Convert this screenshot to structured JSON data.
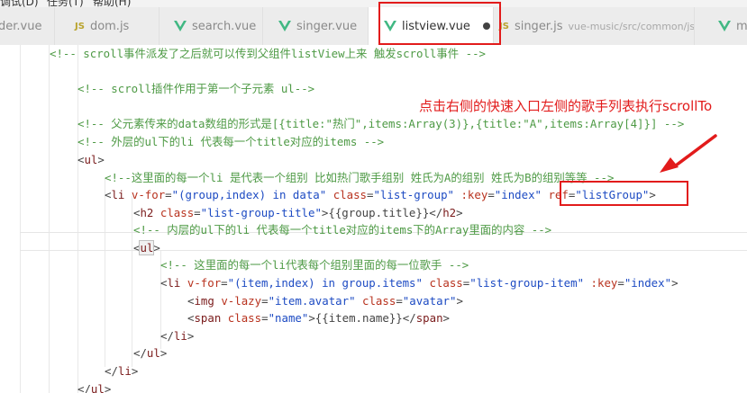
{
  "menu": [
    {
      "label": "调试(D)"
    },
    {
      "label": "任务(T)"
    },
    {
      "label": "帮助(H)"
    }
  ],
  "tabs": [
    {
      "name": "der.vue",
      "icon": "none"
    },
    {
      "name": "dom.js",
      "icon": "js"
    },
    {
      "name": "search.vue",
      "icon": "vue"
    },
    {
      "name": "singer.vue",
      "icon": "vue"
    },
    {
      "name": "listview.vue",
      "icon": "vue",
      "active": true,
      "modified": true
    },
    {
      "name": "singer.js",
      "icon": "js",
      "path": "vue-music/src/common/js"
    },
    {
      "name": "m",
      "icon": "vue"
    }
  ],
  "icons": {
    "js": "JS",
    "vue": "vue-logo-icon",
    "modified": "unsaved-dot-icon"
  },
  "colors": {
    "annotation": "#e21b1b",
    "comment": "#4e9a45",
    "tag": "#7a1b1b",
    "attr": "#b8321e",
    "string": "#1d4bc3"
  },
  "annotation": "点击右侧的快速入口左侧的歌手列表执行scrollTo",
  "code": [
    [
      {
        "k": "c",
        "t": "<!-- scroll事件派发了之后就可以传到父组件listView上来 触发scroll事件 -->"
      }
    ],
    [],
    [
      {
        "k": "c",
        "t": "<!-- scroll插件作用于第一个子元素 ul-->"
      }
    ],
    [],
    [
      {
        "k": "c",
        "t": "<!-- 父元素传来的data数组的形式是[{title:\"热门\",items:Array(3)},{title:\"A\",items:Array[4]}] -->"
      }
    ],
    [
      {
        "k": "c",
        "t": "<!-- 外层的ul下的li 代表每一个title对应的items -->"
      }
    ],
    [
      {
        "k": "p",
        "t": "<"
      },
      {
        "k": "t",
        "t": "ul"
      },
      {
        "k": "p",
        "t": ">"
      }
    ],
    [
      {
        "k": "c",
        "t": "<!--这里面的每一个li 是代表一个组别 比如热门歌手组别 姓氏为A的组别 姓氏为B的组别等等 -->"
      }
    ],
    [
      {
        "k": "p",
        "t": "<"
      },
      {
        "k": "t",
        "t": "li"
      },
      {
        "k": "p",
        "t": " "
      },
      {
        "k": "a",
        "t": "v-for"
      },
      {
        "k": "p",
        "t": "="
      },
      {
        "k": "s",
        "t": "\"(group,index) in data\""
      },
      {
        "k": "p",
        "t": " "
      },
      {
        "k": "a",
        "t": "class"
      },
      {
        "k": "p",
        "t": "="
      },
      {
        "k": "s",
        "t": "\"list-group\""
      },
      {
        "k": "p",
        "t": " "
      },
      {
        "k": "a",
        "t": ":key"
      },
      {
        "k": "p",
        "t": "="
      },
      {
        "k": "s",
        "t": "\"index\""
      },
      {
        "k": "p",
        "t": " "
      },
      {
        "k": "a",
        "t": "ref"
      },
      {
        "k": "p",
        "t": "="
      },
      {
        "k": "s",
        "t": "\"listGroup\""
      },
      {
        "k": "p",
        "t": ">"
      }
    ],
    [
      {
        "k": "p",
        "t": "<"
      },
      {
        "k": "t",
        "t": "h2"
      },
      {
        "k": "p",
        "t": " "
      },
      {
        "k": "a",
        "t": "class"
      },
      {
        "k": "p",
        "t": "="
      },
      {
        "k": "s",
        "t": "\"list-group-title\""
      },
      {
        "k": "p",
        "t": ">{{group.title}}</"
      },
      {
        "k": "t",
        "t": "h2"
      },
      {
        "k": "p",
        "t": ">"
      }
    ],
    [
      {
        "k": "c",
        "t": "<!-- 内层的ul下的li 代表每一个title对应的items下的Array里面的内容 -->"
      }
    ],
    [
      {
        "k": "p",
        "t": "<"
      },
      {
        "k": "t",
        "t": "ul",
        "hl": true
      },
      {
        "k": "p",
        "t": ">"
      }
    ],
    [
      {
        "k": "c",
        "t": "<!-- 这里面的每一个li代表每个组别里面的每一位歌手 -->"
      }
    ],
    [
      {
        "k": "p",
        "t": "<"
      },
      {
        "k": "t",
        "t": "li"
      },
      {
        "k": "p",
        "t": " "
      },
      {
        "k": "a",
        "t": "v-for"
      },
      {
        "k": "p",
        "t": "="
      },
      {
        "k": "s",
        "t": "\"(item,index) in group.items\""
      },
      {
        "k": "p",
        "t": " "
      },
      {
        "k": "a",
        "t": "class"
      },
      {
        "k": "p",
        "t": "="
      },
      {
        "k": "s",
        "t": "\"list-group-item\""
      },
      {
        "k": "p",
        "t": " "
      },
      {
        "k": "a",
        "t": ":key"
      },
      {
        "k": "p",
        "t": "="
      },
      {
        "k": "s",
        "t": "\"index\""
      },
      {
        "k": "p",
        "t": ">"
      }
    ],
    [
      {
        "k": "p",
        "t": "<"
      },
      {
        "k": "t",
        "t": "img"
      },
      {
        "k": "p",
        "t": " "
      },
      {
        "k": "a",
        "t": "v-lazy"
      },
      {
        "k": "p",
        "t": "="
      },
      {
        "k": "s",
        "t": "\"item.avatar\""
      },
      {
        "k": "p",
        "t": " "
      },
      {
        "k": "a",
        "t": "class"
      },
      {
        "k": "p",
        "t": "="
      },
      {
        "k": "s",
        "t": "\"avatar\""
      },
      {
        "k": "p",
        "t": ">"
      }
    ],
    [
      {
        "k": "p",
        "t": "<"
      },
      {
        "k": "t",
        "t": "span"
      },
      {
        "k": "p",
        "t": " "
      },
      {
        "k": "a",
        "t": "class"
      },
      {
        "k": "p",
        "t": "="
      },
      {
        "k": "s",
        "t": "\"name\""
      },
      {
        "k": "p",
        "t": ">{{item.name}}</"
      },
      {
        "k": "t",
        "t": "span"
      },
      {
        "k": "p",
        "t": ">"
      }
    ],
    [
      {
        "k": "p",
        "t": "</"
      },
      {
        "k": "t",
        "t": "li"
      },
      {
        "k": "p",
        "t": ">"
      }
    ],
    [
      {
        "k": "p",
        "t": "</"
      },
      {
        "k": "t",
        "t": "ul"
      },
      {
        "k": "p",
        "t": ">"
      }
    ],
    [
      {
        "k": "p",
        "t": "</"
      },
      {
        "k": "t",
        "t": "li"
      },
      {
        "k": "p",
        "t": ">"
      }
    ],
    [
      {
        "k": "p",
        "t": "</"
      },
      {
        "k": "t",
        "t": "ul"
      },
      {
        "k": "p",
        "t": ">"
      }
    ]
  ]
}
